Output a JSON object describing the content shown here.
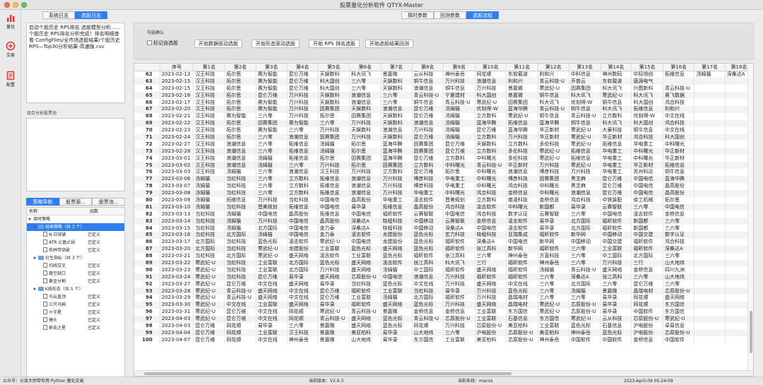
{
  "window": {
    "title": "股票量化分析软件 QTYX-Master"
  },
  "sidebar": {
    "items": [
      {
        "label": "量化",
        "icon": "bar-chart-icon"
      },
      {
        "label": "交易",
        "icon": "trade-icon"
      },
      {
        "label": "配置",
        "icon": "config-icon"
      }
    ]
  },
  "left_tabs": [
    "系统日志",
    "选股日志"
  ],
  "log": {
    "lines": [
      "启动个股历史 RPS排名 选股模型分析……",
      "",
      "个股历史 RPS排名分析完成！排名明细查看 ConfigFiles/全市场选股结果/个股历史 RPS—Top30分析结果-高速版.csv"
    ]
  },
  "combo_label": "组合分析股票池",
  "nav_tabs": [
    "策略导航",
    "股票源...",
    "股票池..."
  ],
  "tree": {
    "headers": [
      "名称",
      "函数"
    ],
    "rows": [
      {
        "name": "择时策略",
        "func": "",
        "level": 0,
        "type": "folder",
        "open": true,
        "selected": false
      },
      {
        "name": "经典策略（共 3 个）",
        "func": "",
        "level": 1,
        "type": "folder",
        "open": true,
        "selected": true
      },
      {
        "name": "N 日突破",
        "func": "已定义",
        "level": 2,
        "type": "file",
        "open": false,
        "selected": false
      },
      {
        "name": "ATR 止盈止损",
        "func": "已定义",
        "level": 2,
        "type": "file",
        "open": false,
        "selected": false
      },
      {
        "name": "布林带突破",
        "func": "已定义",
        "level": 2,
        "type": "file",
        "open": false,
        "selected": false
      },
      {
        "name": "衍生指标（共 3 个）",
        "func": "",
        "level": 1,
        "type": "folder",
        "open": true,
        "selected": false
      },
      {
        "name": "均线交叉",
        "func": "已定义",
        "level": 2,
        "type": "file",
        "open": false,
        "selected": false
      },
      {
        "name": "跳空缺口",
        "func": "已定义",
        "level": 2,
        "type": "file",
        "open": false,
        "selected": false
      },
      {
        "name": "黄金分割",
        "func": "已定义",
        "level": 2,
        "type": "file",
        "open": false,
        "selected": false
      },
      {
        "name": "K线形态（共 5 个）",
        "func": "",
        "level": 1,
        "type": "folder",
        "open": true,
        "selected": false
      },
      {
        "name": "乌云盖顶",
        "func": "已定义",
        "level": 2,
        "type": "file",
        "open": false,
        "selected": false
      },
      {
        "name": "三只乌鸦",
        "func": "已定义",
        "level": 2,
        "type": "file",
        "open": false,
        "selected": false
      },
      {
        "name": "十字星",
        "func": "已定义",
        "level": 2,
        "type": "file",
        "open": false,
        "selected": false
      },
      {
        "name": "锤头",
        "func": "已定义",
        "level": 2,
        "type": "file",
        "open": false,
        "selected": false
      },
      {
        "name": "射击之星",
        "func": "已定义",
        "level": 2,
        "type": "file",
        "open": false,
        "selected": false
      }
    ]
  },
  "top_tabs": [
    "择时参数",
    "回测参数",
    "选股流程"
  ],
  "group": {
    "title": "勾选确认",
    "checkbox": "标记自选股",
    "buttons": [
      "开始数据驱动选股",
      "开始形态驱动选股",
      "开始 RPS 排名选股",
      "开始选股结果回测"
    ]
  },
  "table": {
    "headers": [
      "",
      "序号",
      "第1名",
      "第2名",
      "第3名",
      "第4名",
      "第5名",
      "第6名",
      "第7名",
      "第8名",
      "第9名",
      "第10名",
      "第11名",
      "第12名",
      "第13名",
      "第14名",
      "第15名",
      "第16名",
      "第17名",
      "第18名"
    ],
    "rows": [
      [
        "62",
        "2023-02-13",
        "汉王科技",
        "拓尔思",
        "赛为智能",
        "昆仑万维",
        "天娱数科",
        "科大讯飞",
        "景嘉微",
        "云从科技",
        "神州泰岳",
        "同花顺",
        "东软载波",
        "利和兴",
        "中科信息",
        "神州数码",
        "中际旭创",
        "拓维信息",
        "汤姆猫",
        "深桑达A"
      ],
      [
        "63",
        "2023-02-15",
        "汉王科技",
        "拓尔思",
        "赛为智能",
        "昆仑万维",
        "科大国创",
        "三六零",
        "天娱数科",
        "铜牛信息",
        "万兴科技",
        "浪潮信息",
        "利和兴",
        "青云科技-U",
        "开普云",
        "东软载波",
        "唐源电气"
      ],
      [
        "64",
        "2023-02-15",
        "汉王科技",
        "拓尔思",
        "赛为智能",
        "昆仑万维",
        "科大国创",
        "三六零",
        "天娱数科",
        "浪潮信息",
        "铜牛信息",
        "万兴科技",
        "景嘉微",
        "寒武纪-U",
        "因赛集团",
        "科大讯飞",
        "兴图新科",
        "青云科技-U"
      ],
      [
        "65",
        "2023-02-16",
        "汉王科技",
        "拓尔思",
        "昆仑万维",
        "万兴科技",
        "天娱数科",
        "浪潮信息",
        "三六零",
        "青云科技-U",
        "宁夏建材",
        "科大国创",
        "景嘉微",
        "铜牛信息",
        "科大讯飞",
        "寒武纪-U",
        "科大讯飞",
        "奥飞数据"
      ],
      [
        "66",
        "2023-02-17",
        "汉王科技",
        "拓尔思",
        "赛为智能",
        "万兴科技",
        "天娱数科",
        "浪潮信息",
        "三六零",
        "铜牛信息",
        "青云科技-U",
        "寒武纪-U",
        "因赛集团",
        "科大讯飞",
        "优刻得-W",
        "铜牛信息",
        "科大国创",
        "鸿合科技"
      ],
      [
        "67",
        "2023-02-20",
        "汉王科技",
        "拓尔思",
        "赛为智能",
        "万兴科技",
        "因赛集团",
        "天娱数科",
        "浪潮信息",
        "昆仑万维",
        "汤姆猫",
        "优刻得-W",
        "蓝海华腾",
        "青云科技-U",
        "铜牛信息",
        "科大讯飞",
        "拓维信息",
        "利和兴"
      ],
      [
        "68",
        "2023-02-21",
        "汉王科技",
        "赛为智能",
        "三六零",
        "万兴科技",
        "拓尔思",
        "因赛集团",
        "天娱数科",
        "昆仑万维",
        "汤姆猫",
        "立方数科",
        "寒武纪-U",
        "铜牛信息",
        "青云科技-U",
        "立方数科",
        "优刻得-W",
        "中文在线"
      ],
      [
        "69",
        "2023-02-22",
        "汉王科技",
        "拓尔思",
        "因赛集团",
        "赛为智能",
        "三六零",
        "万兴科技",
        "天娱数科",
        "浪潮信息",
        "汤姆猫",
        "蓝海华腾",
        "拓维信息",
        "蓝海华腾",
        "铜牛信息",
        "科大讯飞",
        "科大国创",
        "鸿合科技"
      ],
      [
        "70",
        "2023-02-23",
        "汉王科技",
        "拓尔思",
        "赛为智能",
        "三六零",
        "万兴科技",
        "天娱数科",
        "浪潮信息",
        "万兴科技",
        "汤姆猫",
        "昆仑万维",
        "蓝海华腾",
        "华正新材",
        "寒武纪-U",
        "大豪科技",
        "铜牛信息",
        "中文在线"
      ],
      [
        "71",
        "2023-02-24",
        "汉王科技",
        "拓尔思",
        "三六零",
        "浪潮信息",
        "因赛集团",
        "万兴科技",
        "天娱数科",
        "昆仑万维",
        "汤姆猫",
        "立方数科",
        "万兴科技",
        "华正新材",
        "寒武纪-U",
        "华正新材",
        "鸿合科技",
        "科大国创"
      ],
      [
        "72",
        "2023-02-27",
        "汉王科技",
        "浪潮信息",
        "三六零",
        "拓维信息",
        "汤姆猫",
        "拓尔思",
        "蓝海华腾",
        "因赛集团",
        "昆仑万维",
        "天娱数科",
        "立方数科",
        "多伦科技",
        "寒武纪-U",
        "拓维信息",
        "华电重工",
        "中科曙光"
      ],
      [
        "73",
        "2023-02-28",
        "汉王科技",
        "浪潮信息",
        "三六零",
        "拓维信息",
        "汤姆猫",
        "拓尔思",
        "蓝海华腾",
        "因赛集团",
        "昆仑万维",
        "立方数科",
        "多伦科技",
        "寒武纪-U",
        "拓维信息",
        "华电重工",
        "中科曙光",
        "华正新材"
      ],
      [
        "74",
        "2023-03-01",
        "汉王科技",
        "浪潮信息",
        "汤姆猫",
        "拓维信息",
        "拓尔思",
        "因赛集团",
        "蓝海华腾",
        "昆仑万维",
        "立方数科",
        "中科曙光",
        "多伦科技",
        "寒武纪-U",
        "拓维信息",
        "华电重工",
        "中科曙光",
        "华正新材"
      ],
      [
        "75",
        "2023-03-02",
        "汉王科技",
        "浪潮信息",
        "汤姆猫",
        "三六零",
        "万兴科技",
        "拓尔思",
        "因赛集团",
        "立方数科",
        "中科曙光",
        "青云科技-U",
        "华正新材",
        "万兴科技",
        "寒武纪-U",
        "华电重工",
        "华正新材",
        "拓维信息"
      ],
      [
        "76",
        "2023-03-03",
        "汉王科技",
        "汤姆猫",
        "三六零",
        "浪潮信息",
        "汉王科技",
        "万兴科技",
        "立方数科",
        "昆仑万维",
        "拓尔思",
        "中科曙光",
        "浪潮信息",
        "博彦科技",
        "万兴科技",
        "华电重工",
        "苏州科达",
        "铜牛信息"
      ],
      [
        "77",
        "2023-03-06",
        "汤姆猫",
        "当虹科技",
        "三六零",
        "立方数科",
        "拓维信息",
        "浪潮信息",
        "万兴科技",
        "博彦科技",
        "华电重工",
        "中科曙光",
        "博彦科技",
        "因赛集团",
        "黑芝麻",
        "昆仑万维",
        "中国电信",
        "蓝海华腾"
      ],
      [
        "78",
        "2023-03-07",
        "汤姆猫",
        "当虹科技",
        "三六零",
        "立方数科",
        "拓维信息",
        "浪潮信息",
        "万兴科技",
        "博彦科技",
        "华电重工",
        "中科曙光",
        "鸿合科技",
        "中科曙光",
        "黑芝麻",
        "昆仑万维",
        "中国电信",
        "晶高股份"
      ],
      [
        "79",
        "2023-03-08",
        "汤姆猫",
        "当虹科技",
        "三六零",
        "立方数科",
        "拓维信息",
        "浪潮信息",
        "万兴科技",
        "华电重工",
        "中科曙光",
        "鸿合科技",
        "金桥信息",
        "中科曙光",
        "浪潮信息",
        "昆仑万维",
        "中国电信",
        "晶高股份"
      ],
      [
        "80",
        "2023-03-09",
        "汤姆猫",
        "拓维信息",
        "万兴科技",
        "当虹科技",
        "中国电信",
        "晶高股份",
        "华电重工",
        "凌志软件",
        "晋美规划",
        "立方数科",
        "南凌科技",
        "金桥信息",
        "鸿合科技",
        "中铁装配",
        "徐工机械",
        "拓尔思"
      ],
      [
        "81",
        "2023-03-10",
        "汤姆猫",
        "当虹科技",
        "晋美规划",
        "拓维信息",
        "中国电信",
        "易华录",
        "拓维信息",
        "晶高股份",
        "鸿合科技",
        "凌志软件",
        "中科曙光",
        "新国都",
        "易华录",
        "云赛智联",
        "三六零",
        "中国电信"
      ],
      [
        "82",
        "2023-03-13",
        "当虹科技",
        "汤姆猫",
        "中国电信",
        "晶高股份",
        "拓维信息",
        "中国电信",
        "福昕软件",
        "云赛智联",
        "中国电信",
        "鸿合科技",
        "数字认证",
        "云赛智联",
        "三六零",
        "中国电信",
        "凌志软件",
        "金桥信息"
      ],
      [
        "83",
        "2023-03-14",
        "当虹科技",
        "汤姆猫",
        "万兴科技",
        "中国电信",
        "晶高股份",
        "深桑达A",
        "晓程科技",
        "中国移动",
        "云赛智联",
        "金桥信息",
        "凌志软件",
        "易华录",
        "北方国际",
        "福昕软件",
        "新国都",
        "三六零"
      ],
      [
        "84",
        "2023-03-15",
        "当虹科技",
        "汤姆猫",
        "北方国际",
        "中国电信",
        "金力泰",
        "深桑达A",
        "晓程科技",
        "中国移动",
        "深桑达A",
        "中国电信",
        "凌志软件",
        "易华录",
        "北方国际",
        "福昕软件",
        "新国都",
        "三六零"
      ],
      [
        "85",
        "2023-03-16",
        "当虹科技",
        "北方国际",
        "汤姆猫",
        "中国电信",
        "金力泰",
        "凌志软件",
        "龙建股份",
        "蓝色光标",
        "宏力科技",
        "晓程科技",
        "亚瑞集成",
        "福昕软件",
        "新华网",
        "中国移动",
        "中国交建",
        "数字认证"
      ],
      [
        "86",
        "2023-03-17",
        "北方国际",
        "当虹科技",
        "蓝色光标",
        "凌志软件",
        "寒武纪-U",
        "中国电信",
        "龙建股份",
        "蓝色光标",
        "福昕软件",
        "深桑达A",
        "中国电信",
        "新华网",
        "中国移动",
        "中国交建",
        "福昕软件",
        "鸿合科技"
      ],
      [
        "87",
        "2023-03-20",
        "北方国际",
        "当虹科技",
        "寒武纪-U",
        "龙建股份",
        "工业富联",
        "蓝色光标",
        "盛天网络",
        "蓝色光标",
        "福昕软件",
        "张江高科",
        "新华网",
        "福昕软件",
        "三六零",
        "工业富联",
        "福昕软件",
        "深桑达A"
      ],
      [
        "88",
        "2023-03-21",
        "当虹科技",
        "北方国际",
        "寒武纪-U",
        "盛天网络",
        "凌志软件",
        "工业富联",
        "蓝色光标",
        "福昕软件",
        "张江高科",
        "三六零",
        "神州泰岳",
        "方直科技",
        "三六零",
        "中工国际",
        "北方国际",
        "三六零"
      ],
      [
        "89",
        "2023-03-22",
        "寒武纪-U",
        "当虹科技",
        "工业富联",
        "北方国际",
        "蓝色光标",
        "盛天网络",
        "凌志软件",
        "张江高科",
        "科大讯飞",
        "三行",
        "福昕软件",
        "神州泰岳",
        "三六零",
        "万兴科技",
        "三行",
        "山大地纬"
      ],
      [
        "90",
        "2023-03-23",
        "寒武纪-U",
        "当虹科技",
        "工业富联",
        "北方国际",
        "万兴科技",
        "盛天网络",
        "汤姆猫",
        "中工国际",
        "福昕软件",
        "盛天网络",
        "福昕软件",
        "汤姆猫",
        "青云科技-U",
        "盛天网络",
        "金桥信息",
        "四川九洲"
      ],
      [
        "91",
        "2023-03-24",
        "寒武纪-U",
        "当虹科技",
        "昆仑万维",
        "易华录",
        "盛天网络",
        "芯原股份-U",
        "中国电信",
        "浪潮信息",
        "万兴科技",
        "福昕软件",
        "福昕软件",
        "三六零",
        "深桑达A",
        "张江高科",
        "三六零",
        "山大地纬"
      ],
      [
        "92",
        "2023-03-27",
        "寒武纪-U",
        "昆仑万维",
        "中文在线",
        "盛天网络",
        "易华录",
        "当虹科技",
        "蓝色光标",
        "中文在线",
        "万兴科技",
        "盛天网络",
        "中文在线",
        "三六零",
        "北方国际",
        "三六零",
        "昆仑万维",
        "三六零"
      ],
      [
        "93",
        "2023-03-28",
        "寒武纪-U",
        "青云科技-U",
        "盛天网络",
        "中文在线",
        "昆仑万维",
        "福昕软件",
        "工业富联",
        "当虹科技",
        "易华录",
        "万兴科技",
        "蓝色光标",
        "三六零",
        "汤姆猫",
        "景嘉微",
        "晶瑞电材",
        "芯原股份-U"
      ],
      [
        "94",
        "2023-03-29",
        "寒武纪-U",
        "青云科技-U",
        "盛天网络",
        "中文在线",
        "昆仑万维",
        "工业富联",
        "汤姆猫",
        "北方国际",
        "福昕软件",
        "万兴科技",
        "晶瑞电材",
        "三六零",
        "三六零",
        "易华录",
        "同花顺",
        "盛天网络"
      ],
      [
        "95",
        "2023-03-30",
        "寒武纪-U",
        "中文在线",
        "工业富联",
        "盛天网络",
        "易华录",
        "福昕软件",
        "盛天网络",
        "蓝色光标",
        "万兴科技",
        "盛天网络",
        "晶瑞电材",
        "寒武纪-U",
        "芯原股份-U",
        "易华录",
        "同花顺",
        "东方国信"
      ],
      [
        "96",
        "2023-03-31",
        "寒武纪-U",
        "昆仑万维",
        "中文在线",
        "同花顺",
        "寒武纪-U",
        "青云科技-U",
        "景嘉微",
        "金桥信息",
        "金桥信息",
        "工业富联",
        "东方国信",
        "寒武纪-U",
        "芯原股份-U",
        "易华录",
        "中国软件",
        "东方国信"
      ],
      [
        "97",
        "2023-04-03",
        "寒武纪-U",
        "昆仑万维",
        "中文在线",
        "同花顺",
        "青云科技-U",
        "盛天网络",
        "蓝色光标",
        "青云科技-U",
        "芯原股份-U",
        "工业富联",
        "石基信息",
        "东方国信",
        "寒武纪-U",
        "云从科技",
        "芯原股份-U",
        "寒武纪-U"
      ],
      [
        "98",
        "2023-04-03",
        "昆仑万维",
        "同花顺",
        "易华录",
        "三六零",
        "景嘉微",
        "盛天网络",
        "蓝色光标",
        "同花顺",
        "万兴科技",
        "芯原股份-U",
        "美亚柏科",
        "工业富联",
        "蓝色光标",
        "石基信息",
        "沪电股份",
        "卓易信息"
      ],
      [
        "99",
        "2023-04-04",
        "昆仑万维",
        "同花顺",
        "工业富联",
        "汉王科技",
        "景嘉微",
        "美亚柏科",
        "易华录",
        "山大地纬",
        "三六零",
        "沪电股份",
        "芯原股份-U",
        "美亚柏科",
        "神州泰岳",
        "蓝色光标",
        "沪电股份",
        "芯原股份-U"
      ],
      [
        "100",
        "2023-04-07",
        "昆仑万维",
        "同花顺",
        "中文在线",
        "神州泰岳",
        "景嘉微",
        "山大地纬",
        "易华录",
        "东方国信",
        "工业富联",
        "美亚柏科",
        "芯原股份-U",
        "神州泰岳",
        "中国软件",
        "中国软件",
        "金桥信息",
        "中国软件"
      ]
    ]
  },
  "status": {
    "left": "公众号：元宵大师带你用 Python 量化交易",
    "version": "当前版本：V2.6.3",
    "system": "当前系统：macos",
    "time": "2023-April-09 05:24:09"
  }
}
